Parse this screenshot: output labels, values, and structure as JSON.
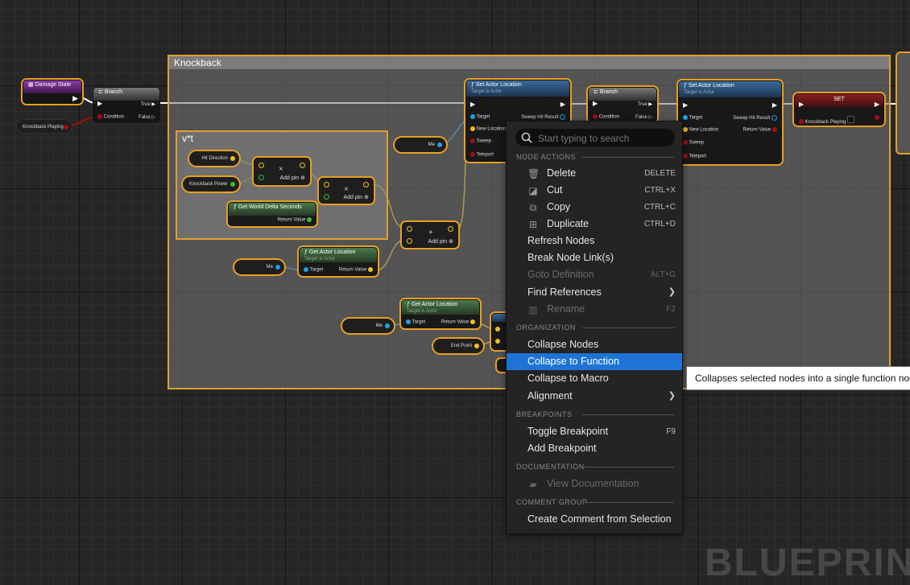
{
  "graph": {
    "comment_knockback": "Knockback",
    "comment_vt": "v*t",
    "nodes": {
      "damage_state": "Damage State",
      "knockback_playing_var": "Knockback Playing",
      "branch1": {
        "title": "Branch",
        "true": "True",
        "condition": "Condition",
        "false": "False"
      },
      "set_actor_location1": {
        "title": "Set Actor Location",
        "sub": "Target is Actor",
        "target": "Target",
        "sweep_hit": "Sweep Hit Result",
        "new_location": "New Location",
        "sweep": "Sweep",
        "teleport": "Teleport"
      },
      "branch2": {
        "title": "Branch",
        "true": "True",
        "condition": "Condition",
        "false": "False"
      },
      "set_actor_location2": {
        "title": "Set Actor Location",
        "sub": "Target is Actor",
        "target": "Target",
        "sweep_hit": "Sweep Hit Result",
        "new_location": "New Location",
        "return_value": "Return Value",
        "sweep": "Sweep",
        "teleport": "Teleport"
      },
      "set": {
        "title": "SET",
        "knockback_playing": "Knockback Playing"
      },
      "me1": "Me",
      "hit_direction": "Hit Direction",
      "knockback_power": "Knockback Power",
      "multiply1": {
        "symbol": "×",
        "add_pin": "Add pin"
      },
      "multiply2": {
        "symbol": "×",
        "add_pin": "Add pin"
      },
      "get_world_delta": {
        "title": "Get World Delta Seconds",
        "return_value": "Return Value"
      },
      "add": {
        "symbol": "+",
        "add_pin": "Add pin"
      },
      "me2": "Me",
      "get_actor_location1": {
        "title": "Get Actor Location",
        "sub": "Target is Actor",
        "target": "Target",
        "return_value": "Return Value"
      },
      "get_actor_location2": {
        "title": "Get Actor Location",
        "sub": "Target is Actor",
        "target": "Target",
        "return_value": "Return Value"
      },
      "me3": "Me",
      "end_point": "End Point"
    }
  },
  "context_menu": {
    "search_placeholder": "Start typing to search",
    "sections": {
      "node_actions": "NODE ACTIONS",
      "organization": "ORGANIZATION",
      "breakpoints": "BREAKPOINTS",
      "documentation": "DOCUMENTATION",
      "comment_group": "COMMENT GROUP"
    },
    "items": {
      "delete": {
        "label": "Delete",
        "shortcut": "DELETE"
      },
      "cut": {
        "label": "Cut",
        "shortcut": "CTRL+X"
      },
      "copy": {
        "label": "Copy",
        "shortcut": "CTRL+C"
      },
      "duplicate": {
        "label": "Duplicate",
        "shortcut": "CTRL+D"
      },
      "refresh_nodes": {
        "label": "Refresh Nodes"
      },
      "break_links": {
        "label": "Break Node Link(s)"
      },
      "goto_definition": {
        "label": "Goto Definition",
        "shortcut": "ALT+G"
      },
      "find_references": {
        "label": "Find References"
      },
      "rename": {
        "label": "Rename",
        "shortcut": "F2"
      },
      "collapse_nodes": {
        "label": "Collapse Nodes"
      },
      "collapse_to_function": {
        "label": "Collapse to Function"
      },
      "collapse_to_macro": {
        "label": "Collapse to Macro"
      },
      "alignment": {
        "label": "Alignment"
      },
      "toggle_breakpoint": {
        "label": "Toggle Breakpoint",
        "shortcut": "F9"
      },
      "add_breakpoint": {
        "label": "Add Breakpoint"
      },
      "view_documentation": {
        "label": "View Documentation"
      },
      "create_comment": {
        "label": "Create Comment from Selection"
      }
    },
    "icons": {
      "search": "search-icon",
      "delete": "trash-icon",
      "cut": "cut-icon",
      "copy": "copy-icon",
      "duplicate": "duplicate-icon",
      "rename": "rename-icon",
      "documentation": "book-icon"
    }
  },
  "tooltip": "Collapses selected nodes into a single function node.",
  "watermark": "BLUEPRINT",
  "colors": {
    "selection": "#e8a020",
    "highlight": "#1d74d6",
    "exec": "#ffffff",
    "bool": "#9a0000",
    "vector": "#f0c020",
    "float": "#30c030",
    "object": "#20a0e0"
  }
}
